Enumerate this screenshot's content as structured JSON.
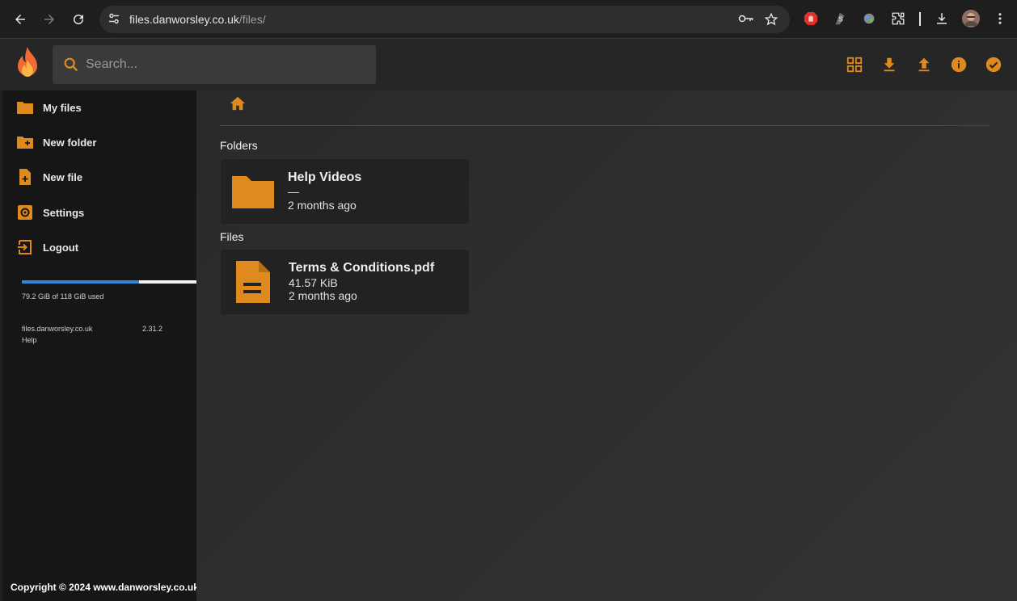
{
  "browser": {
    "url_host": "files.danworsley.co.uk",
    "url_path": "/files/"
  },
  "search": {
    "placeholder": "Search..."
  },
  "sidebar": {
    "items": [
      {
        "label": "My files",
        "icon": "folder-icon"
      },
      {
        "label": "New folder",
        "icon": "folder-plus-icon"
      },
      {
        "label": "New file",
        "icon": "file-plus-icon"
      },
      {
        "label": "Settings",
        "icon": "gear-icon"
      },
      {
        "label": "Logout",
        "icon": "logout-icon"
      }
    ],
    "usage": {
      "text": "79.2 GiB of 118 GiB used",
      "fraction": 0.671
    },
    "site": "files.danworsley.co.uk",
    "help": "Help",
    "version": "2.31.2",
    "copyright": "Copyright © 2024 www.danworsley.co.uk"
  },
  "main": {
    "folders_title": "Folders",
    "files_title": "Files",
    "folders": [
      {
        "name": "Help Videos",
        "size": "—",
        "modified": "2 months ago"
      }
    ],
    "files": [
      {
        "name": "Terms & Conditions.pdf",
        "size": "41.57 KiB",
        "modified": "2 months ago"
      }
    ]
  },
  "colors": {
    "accent": "#e08a1e",
    "usage_bar": "#2e86de"
  }
}
